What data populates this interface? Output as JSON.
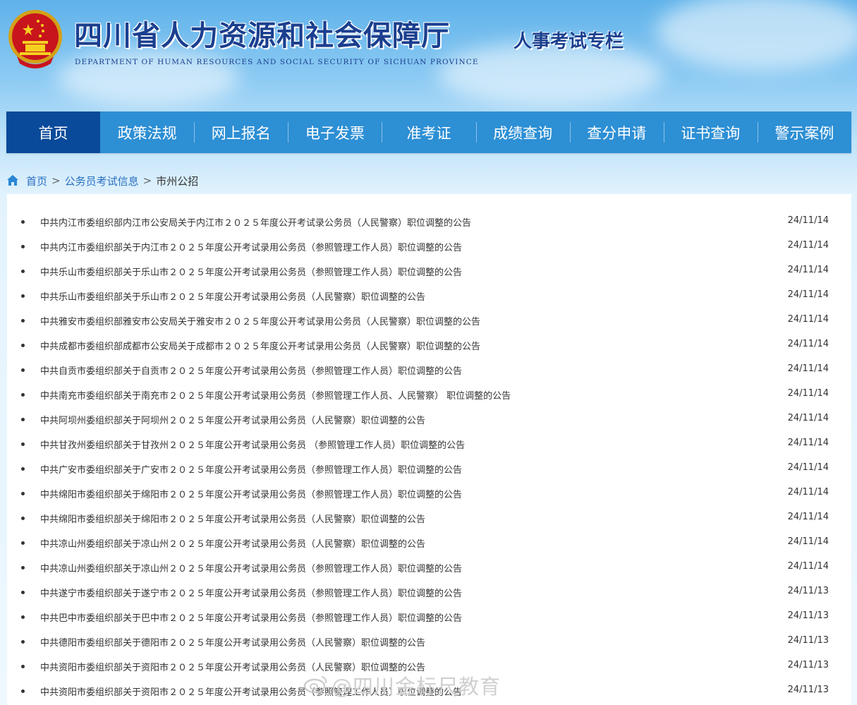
{
  "header": {
    "title": "四川省人力资源和社会保障厅",
    "subtitle": "DEPARTMENT OF HUMAN RESOURCES AND SOCIAL SECURITY OF SICHUAN PROVINCE",
    "column_tag": "人事考试专栏"
  },
  "nav": {
    "items": [
      {
        "label": "首页",
        "active": true
      },
      {
        "label": "政策法规"
      },
      {
        "label": "网上报名"
      },
      {
        "label": "电子发票"
      },
      {
        "label": "准考证"
      },
      {
        "label": "成绩查询"
      },
      {
        "label": "查分申请"
      },
      {
        "label": "证书查询"
      },
      {
        "label": "警示案例"
      }
    ]
  },
  "breadcrumb": {
    "home": "首页",
    "separator": ">",
    "section": "公务员考试信息",
    "current": "市州公招"
  },
  "announcements": [
    {
      "title": "中共内江市委组织部内江市公安局关于内江市２０２５年度公开考试录公务员（人民警察）职位调整的公告",
      "date": "24/11/14"
    },
    {
      "title": "中共内江市委组织部关于内江市２０２５年度公开考试录用公务员（参照管理工作人员）职位调整的公告",
      "date": "24/11/14"
    },
    {
      "title": "中共乐山市委组织部关于乐山市２０２５年度公开考试录用公务员（参照管理工作人员）职位调整的公告",
      "date": "24/11/14"
    },
    {
      "title": "中共乐山市委组织部关于乐山市２０２５年度公开考试录用公务员（人民警察）职位调整的公告",
      "date": "24/11/14"
    },
    {
      "title": "中共雅安市委组织部雅安市公安局关于雅安市２０２５年度公开考试录用公务员（人民警察）职位调整的公告",
      "date": "24/11/14"
    },
    {
      "title": "中共成都市委组织部成都市公安局关于成都市２０２５年度公开考试录用公务员（人民警察）职位调整的公告",
      "date": "24/11/14"
    },
    {
      "title": "中共自贡市委组织部关于自贡市２０２５年度公开考试录用公务员（参照管理工作人员）职位调整的公告",
      "date": "24/11/14"
    },
    {
      "title": "中共南充市委组织部关于南充市２０２５年度公开考试录用公务员（参照管理工作人员、人民警察） 职位调整的公告",
      "date": "24/11/14"
    },
    {
      "title": "中共阿坝州委组织部关于阿坝州２０２５年度公开考试录用公务员（人民警察）职位调整的公告",
      "date": "24/11/14"
    },
    {
      "title": "中共甘孜州委组织部关于甘孜州２０２５年度公开考试录用公务员 （参照管理工作人员）职位调整的公告",
      "date": "24/11/14"
    },
    {
      "title": "中共广安市委组织部关于广安市２０２５年度公开考试录用公务员（参照管理工作人员）职位调整的公告",
      "date": "24/11/14"
    },
    {
      "title": "中共绵阳市委组织部关于绵阳市２０２５年度公开考试录用公务员（参照管理工作人员）职位调整的公告",
      "date": "24/11/14"
    },
    {
      "title": "中共绵阳市委组织部关于绵阳市２０２５年度公开考试录用公务员（人民警察）职位调整的公告",
      "date": "24/11/14"
    },
    {
      "title": "中共凉山州委组织部关于凉山州２０２５年度公开考试录用公务员（人民警察）职位调整的公告",
      "date": "24/11/14"
    },
    {
      "title": "中共凉山州委组织部关于凉山州２０２５年度公开考试录用公务员（参照管理工作人员）职位调整的公告",
      "date": "24/11/14"
    },
    {
      "title": "中共遂宁市委组织部关于遂宁市２０２５年度公开考试录用公务员（参照管理工作人员）职位调整的公告",
      "date": "24/11/13"
    },
    {
      "title": "中共巴中市委组织部关于巴中市２０２５年度公开考试录用公务员（参照管理工作人员）职位调整的公告",
      "date": "24/11/13"
    },
    {
      "title": "中共德阳市委组织部关于德阳市２０２５年度公开考试录用公务员（人民警察）职位调整的公告",
      "date": "24/11/13"
    },
    {
      "title": "中共资阳市委组织部关于资阳市２０２５年度公开考试录用公务员（人民警察）职位调整的公告",
      "date": "24/11/13"
    },
    {
      "title": "中共资阳市委组织部关于资阳市２０２５年度公开考试录用公务员（参照管理工作人员）职位调整的公告",
      "date": "24/11/13"
    }
  ],
  "watermark": {
    "text": "@四川金标尺教育"
  },
  "icons": {
    "emblem": "national-emblem-icon",
    "home": "home-icon",
    "bullet": "bullet-icon",
    "watermark_logo": "weibo-icon"
  },
  "colors": {
    "nav_bg": "#2d8fd4",
    "nav_active": "#0a4a9a",
    "title": "#1b3f8f",
    "link": "#2a6fc0"
  }
}
